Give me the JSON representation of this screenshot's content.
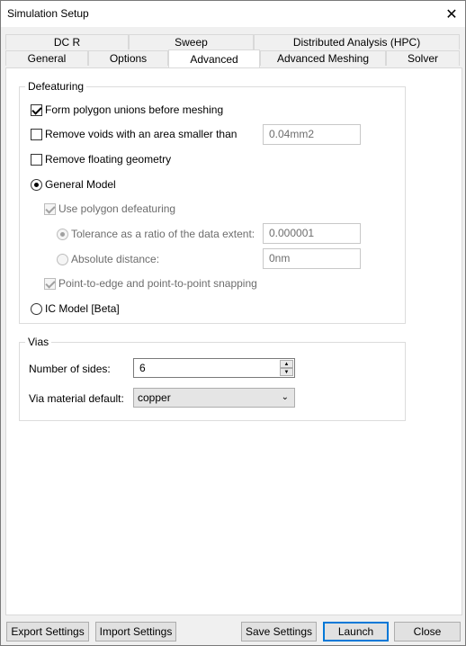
{
  "window": {
    "title": "Simulation Setup"
  },
  "tabs": {
    "row1": [
      "DC R",
      "Sweep",
      "Distributed Analysis (HPC)"
    ],
    "row2": [
      "General",
      "Options",
      "Advanced",
      "Advanced Meshing",
      "Solver"
    ],
    "active": "Advanced"
  },
  "defeaturing": {
    "title": "Defeaturing",
    "form_polygon_unions": {
      "label": "Form polygon unions before meshing",
      "checked": true
    },
    "remove_voids": {
      "label": "Remove voids with an area smaller than",
      "checked": false,
      "value": "0.04mm2"
    },
    "remove_floating": {
      "label": "Remove floating geometry",
      "checked": false
    },
    "general_model": {
      "label": "General Model",
      "selected": true
    },
    "use_polygon_defeaturing": {
      "label": "Use polygon defeaturing",
      "checked": true,
      "enabled": false
    },
    "tolerance": {
      "label": "Tolerance as a ratio of the data extent:",
      "selected": true,
      "value": "0.000001"
    },
    "absolute": {
      "label": "Absolute distance:",
      "selected": false,
      "value": "0nm"
    },
    "snapping": {
      "label": "Point-to-edge and point-to-point snapping",
      "checked": true,
      "enabled": false
    },
    "ic_model": {
      "label": "IC Model [Beta]",
      "selected": false
    }
  },
  "vias": {
    "title": "Vias",
    "num_sides": {
      "label": "Number of sides:",
      "value": "6"
    },
    "material": {
      "label": "Via material default:",
      "value": "copper"
    }
  },
  "footer": {
    "export": "Export Settings",
    "import": "Import Settings",
    "save": "Save Settings",
    "launch": "Launch",
    "close": "Close"
  },
  "colors": {
    "accent": "#0078d7"
  }
}
